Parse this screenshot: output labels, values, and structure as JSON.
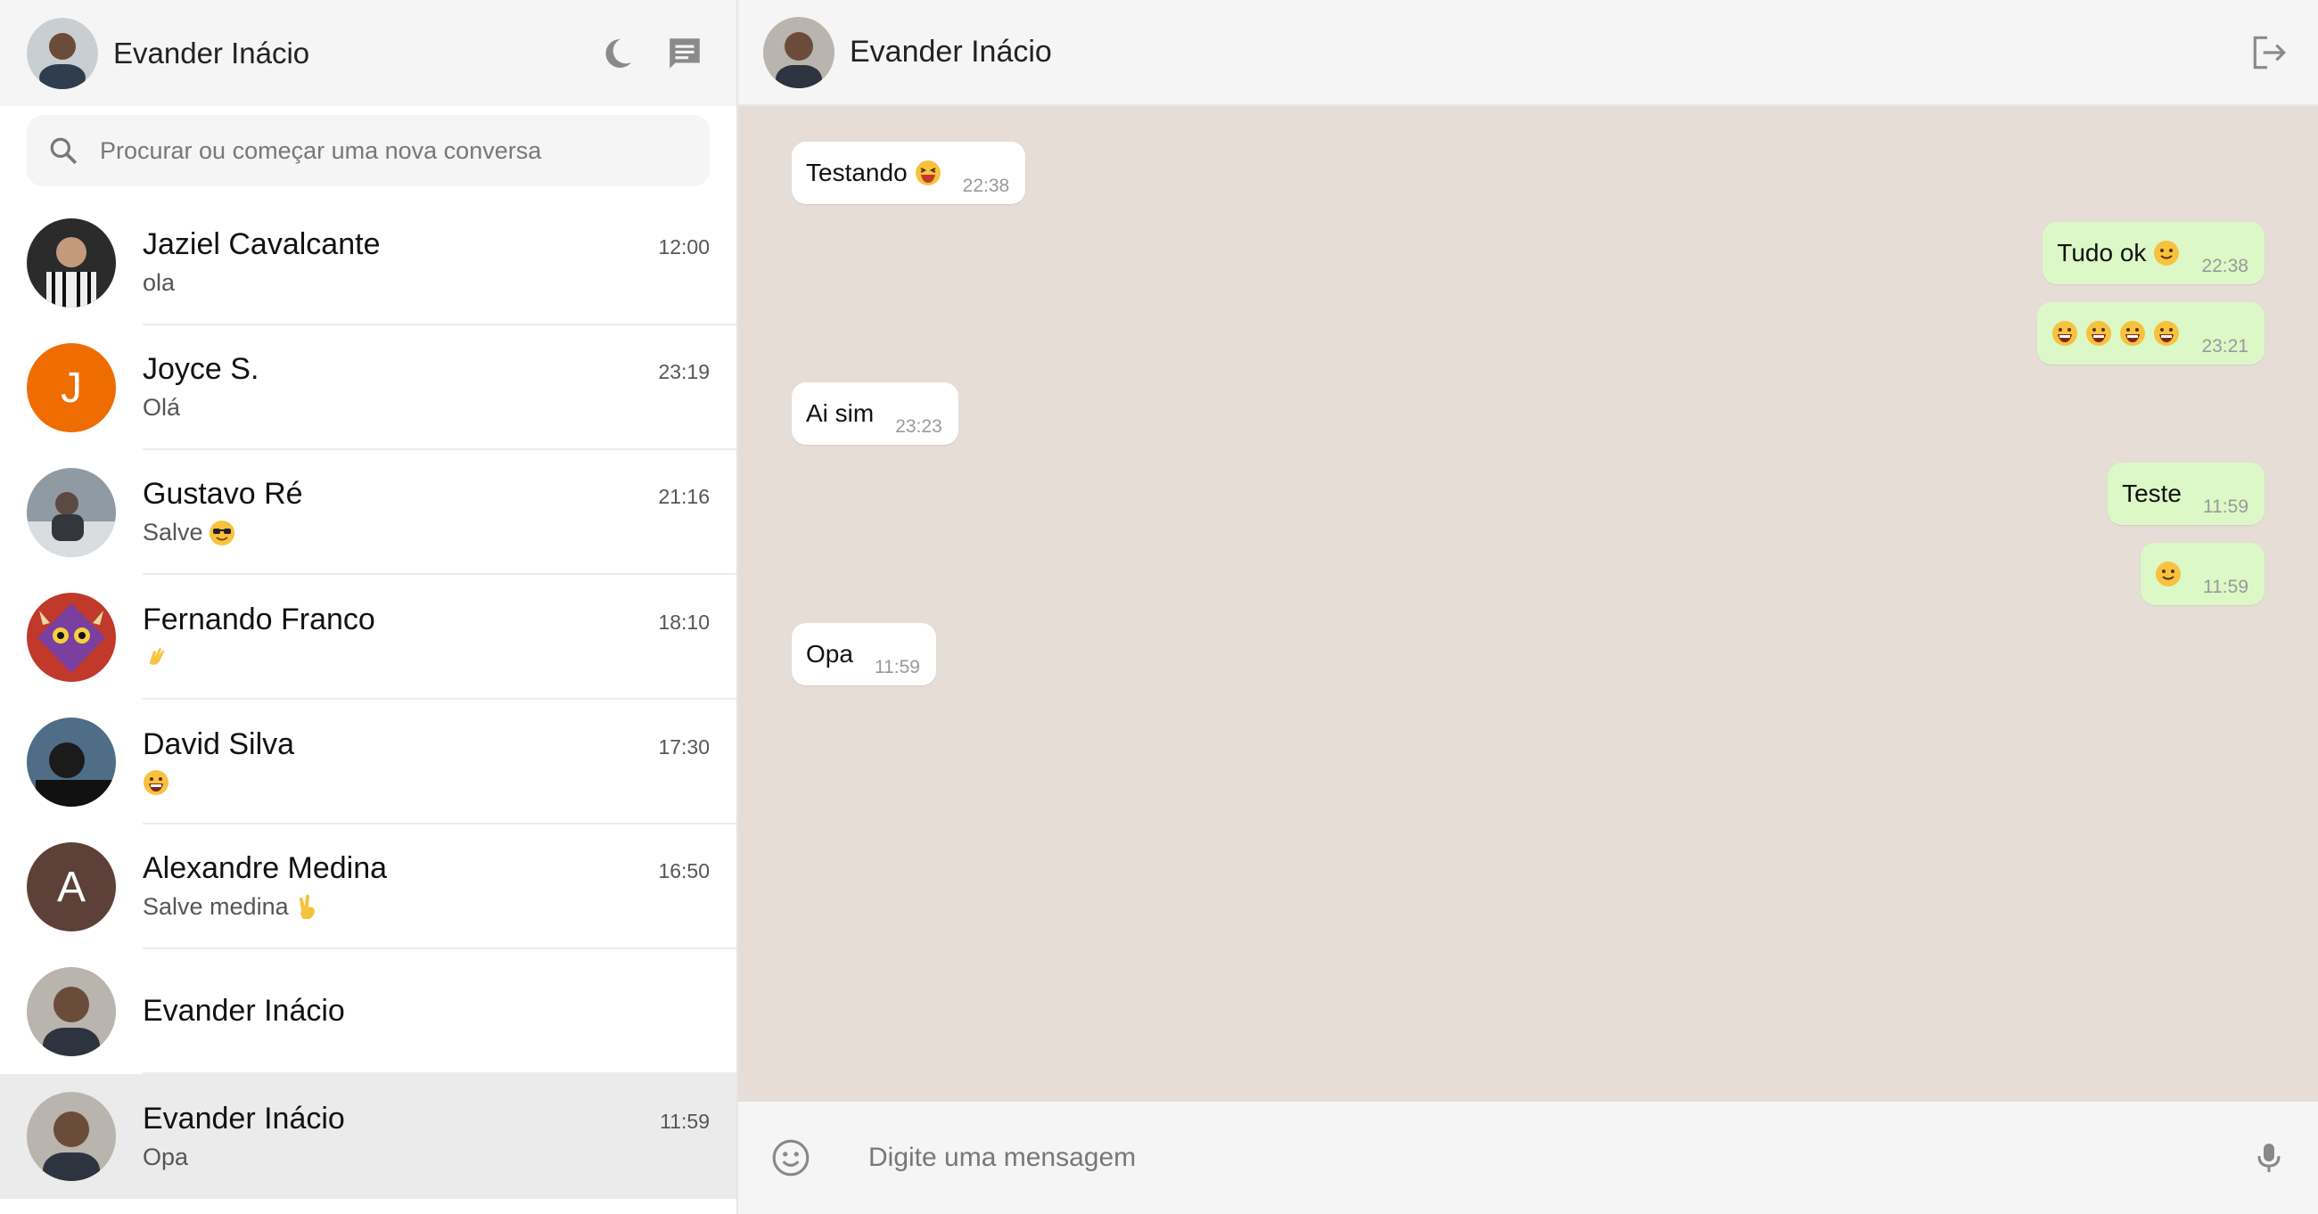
{
  "colors": {
    "accent_out_bubble": "#dcf8c6",
    "chat_background": "#e5ddd6",
    "header_background": "#f5f5f5",
    "avatar_j": "#ef6c00",
    "avatar_a": "#5d4037"
  },
  "sidebar": {
    "user": {
      "name": "Evander Inácio",
      "avatar_icon": "user-photo-avatar"
    },
    "actions": {
      "theme_icon": "moon-icon",
      "new_chat_icon": "message-icon"
    },
    "search": {
      "placeholder": "Procurar ou começar uma nova conversa",
      "value": ""
    },
    "chats": [
      {
        "name": "Jaziel Cavalcante",
        "time": "12:00",
        "last": "ola",
        "emoji": "",
        "avatar": "photo"
      },
      {
        "name": "Joyce S.",
        "time": "23:19",
        "last": "Olá",
        "emoji": "",
        "avatar": "letter",
        "letter": "J"
      },
      {
        "name": "Gustavo Ré",
        "time": "21:16",
        "last": "Salve",
        "emoji": "sunglasses-emoji",
        "avatar": "photo"
      },
      {
        "name": "Fernando Franco",
        "time": "18:10",
        "last": "",
        "emoji": "waving-hand-emoji",
        "avatar": "photo"
      },
      {
        "name": "David Silva",
        "time": "17:30",
        "last": "",
        "emoji": "grinning-face-emoji",
        "avatar": "photo"
      },
      {
        "name": "Alexandre Medina",
        "time": "16:50",
        "last": "Salve medina",
        "emoji": "victory-hand-emoji",
        "avatar": "letter",
        "letter": "A"
      },
      {
        "name": "Evander Inácio",
        "time": "",
        "last": "",
        "emoji": "",
        "avatar": "photo"
      },
      {
        "name": "Evander Inácio",
        "time": "11:59",
        "last": "Opa",
        "emoji": "",
        "avatar": "photo",
        "active": true
      }
    ]
  },
  "chat": {
    "header": {
      "name": "Evander Inácio",
      "logout_icon": "logout-icon"
    },
    "messages": [
      {
        "dir": "in",
        "text": "Testando",
        "emojis": 1,
        "time": "22:38"
      },
      {
        "dir": "out",
        "text": "Tudo ok",
        "emojis": 1,
        "time": "22:38"
      },
      {
        "dir": "out",
        "text": "",
        "emojis": 4,
        "time": "23:21"
      },
      {
        "dir": "in",
        "text": "Ai sim",
        "emojis": 0,
        "time": "23:23"
      },
      {
        "dir": "out",
        "text": "Teste",
        "emojis": 0,
        "time": "11:59"
      },
      {
        "dir": "out",
        "text": "",
        "emojis": 1,
        "time": "11:59"
      },
      {
        "dir": "in",
        "text": "Opa",
        "emojis": 0,
        "time": "11:59"
      }
    ],
    "composer": {
      "placeholder": "Digite uma mensagem",
      "value": "",
      "emoji_icon": "emoji-picker-icon",
      "mic_icon": "microphone-icon"
    }
  }
}
